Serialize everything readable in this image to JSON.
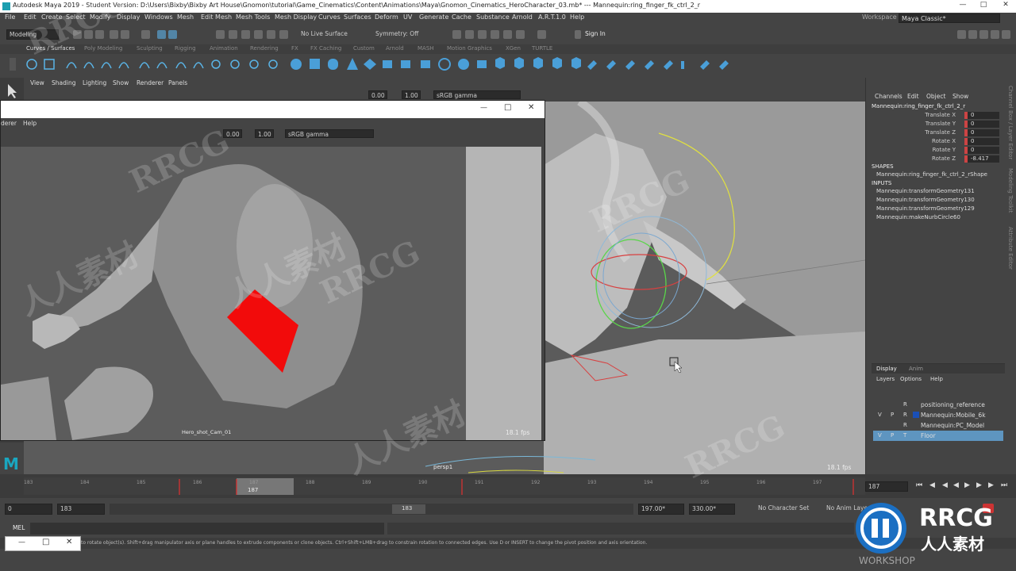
{
  "window": {
    "title": "Autodesk Maya 2019 - Student Version: D:\\Users\\Bixby\\Bixby Art House\\Gnomon\\tutorial\\Game_Cinematics\\Content\\Animations\\Maya\\Gnomon_Cinematics_HeroCharacter_03.mb*  ---  Mannequin:ring_finger_fk_ctrl_2_r"
  },
  "menubar": [
    "File",
    "Edit",
    "Create",
    "Select",
    "Modify",
    "Display",
    "Windows",
    "Mesh",
    "Edit Mesh",
    "Mesh Tools",
    "Mesh Display",
    "Curves",
    "Surfaces",
    "Deform",
    "UV",
    "Generate",
    "Cache",
    "Substance",
    "Arnold",
    "A.R.T.1.0",
    "Help"
  ],
  "workspace": {
    "label": "Workspace :",
    "value": "Maya Classic*"
  },
  "status": {
    "mode": "Modeling",
    "live_surface": "No Live Surface",
    "symmetry": "Symmetry: Off",
    "sign_in": "Sign In"
  },
  "shelf_tabs": [
    "Curves / Surfaces",
    "Poly Modeling",
    "Sculpting",
    "Rigging",
    "Animation",
    "Rendering",
    "FX",
    "FX Caching",
    "Custom",
    "Arnold",
    "MASH",
    "Motion Graphics",
    "XGen",
    "TURTLE"
  ],
  "panel_menu": [
    "View",
    "Shading",
    "Lighting",
    "Show",
    "Renderer",
    "Panels"
  ],
  "panel_toolbar": {
    "exposure": "0.00",
    "gamma": "1.00",
    "colorspace": "sRGB gamma"
  },
  "viewport": {
    "camera": "persp1",
    "fps": "18.1 fps"
  },
  "float_window": {
    "menu": [
      "derer",
      "Help"
    ],
    "exposure": "0.00",
    "gamma": "1.00",
    "colorspace": "sRGB gamma",
    "camera": "Hero_shot_Cam_01",
    "fps": "18.1 fps"
  },
  "channel_box": {
    "menu": [
      "Channels",
      "Edit",
      "Object",
      "Show"
    ],
    "object": "Mannequin:ring_finger_fk_ctrl_2_r",
    "channels": [
      {
        "name": "Translate X",
        "value": "0"
      },
      {
        "name": "Translate Y",
        "value": "0"
      },
      {
        "name": "Translate Z",
        "value": "0"
      },
      {
        "name": "Rotate X",
        "value": "0"
      },
      {
        "name": "Rotate Y",
        "value": "0"
      },
      {
        "name": "Rotate Z",
        "value": "-8.417"
      }
    ],
    "shapes_header": "SHAPES",
    "shape": "Mannequin:ring_finger_fk_ctrl_2_rShape",
    "inputs_header": "INPUTS",
    "inputs": [
      "Mannequin:transformGeometry131",
      "Mannequin:transformGeometry130",
      "Mannequin:transformGeometry129",
      "Mannequin:makeNurbCircle60"
    ]
  },
  "side_labels": [
    "Channel Box / Layer Editor",
    "Modeling Toolkit",
    "Attribute Editor"
  ],
  "layer_editor": {
    "tabs": [
      "Display",
      "Anim"
    ],
    "menu": [
      "Layers",
      "Options",
      "Help"
    ],
    "layers": [
      {
        "v": "",
        "p": "",
        "r": "R",
        "name": "positioning_reference",
        "color": ""
      },
      {
        "v": "V",
        "p": "P",
        "r": "R",
        "name": "Mannequin:Mobile_6k",
        "color": "#1a4fb5"
      },
      {
        "v": "",
        "p": "",
        "r": "R",
        "name": "Mannequin:PC_Model",
        "color": ""
      },
      {
        "v": "V",
        "p": "P",
        "r": "T",
        "name": "Floor",
        "color": ""
      }
    ]
  },
  "timeline": {
    "ticks": [
      "183",
      "184",
      "185",
      "186",
      "187",
      "188",
      "189",
      "190",
      "191",
      "192",
      "193",
      "194",
      "195",
      "196",
      "197"
    ],
    "current": "187",
    "current_field": "187"
  },
  "range": {
    "start": "0",
    "start_inner": "183",
    "slider_label": "183",
    "end_inner": "197.00*",
    "end": "330.00*",
    "character_set": "No Character Set",
    "anim_layer": "No Anim Layer"
  },
  "command_line": {
    "lang": "MEL"
  },
  "help_line": "to rotate object(s). Shift+drag manipulator axis or plane handles to extrude components or clone objects. Ctrl+Shift+LMB+drag to constrain rotation to connected edges. Use D or INSERT to change the pivot position and axis orientation.",
  "watermarks": [
    "RRCG",
    "人人素材",
    "RRCG",
    "人人素材",
    "RRCG",
    "RRCG",
    "人人素材",
    "RRCG"
  ],
  "logo": {
    "brand": "RRCG",
    "sub": "人人素材",
    "tag": "WORKSHOP"
  }
}
